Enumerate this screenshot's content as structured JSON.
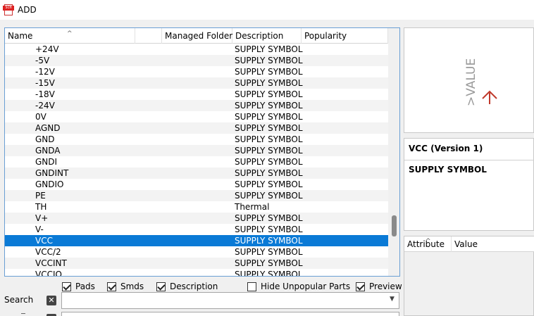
{
  "window": {
    "title": "ADD",
    "icon": "sch-icon"
  },
  "table": {
    "columns": [
      "Name",
      "",
      "Managed Folder",
      "Description",
      "Popularity"
    ],
    "rows": [
      {
        "name": "+24V",
        "description": "SUPPLY SYMBOL"
      },
      {
        "name": "-5V",
        "description": "SUPPLY SYMBOL"
      },
      {
        "name": "-12V",
        "description": "SUPPLY SYMBOL"
      },
      {
        "name": "-15V",
        "description": "SUPPLY SYMBOL"
      },
      {
        "name": "-18V",
        "description": "SUPPLY SYMBOL"
      },
      {
        "name": "-24V",
        "description": "SUPPLY SYMBOL"
      },
      {
        "name": "0V",
        "description": "SUPPLY SYMBOL"
      },
      {
        "name": "AGND",
        "description": "SUPPLY SYMBOL"
      },
      {
        "name": "GND",
        "description": "SUPPLY SYMBOL"
      },
      {
        "name": "GNDA",
        "description": "SUPPLY SYMBOL"
      },
      {
        "name": "GNDI",
        "description": "SUPPLY SYMBOL"
      },
      {
        "name": "GNDINT",
        "description": "SUPPLY SYMBOL"
      },
      {
        "name": "GNDIO",
        "description": "SUPPLY SYMBOL"
      },
      {
        "name": "PE",
        "description": "SUPPLY SYMBOL"
      },
      {
        "name": "TH",
        "description": "Thermal"
      },
      {
        "name": "V+",
        "description": "SUPPLY SYMBOL"
      },
      {
        "name": "V-",
        "description": "SUPPLY SYMBOL"
      },
      {
        "name": "VCC",
        "description": "SUPPLY SYMBOL",
        "selected": true
      },
      {
        "name": "VCC/2",
        "description": "SUPPLY SYMBOL"
      },
      {
        "name": "VCCINT",
        "description": "SUPPLY SYMBOL"
      },
      {
        "name": "VCCIO",
        "description": "SUPPLY SYMBOL"
      }
    ]
  },
  "preview": {
    "symbol_text": ">VALUE",
    "arrow_color": "#c0392b",
    "text_color": "#9a9a9a"
  },
  "info": {
    "title": "VCC (Version 1)",
    "description": "SUPPLY SYMBOL"
  },
  "attributes": {
    "columns": [
      "Attribute",
      "Value"
    ]
  },
  "options": [
    {
      "label": "Pads",
      "checked": true
    },
    {
      "label": "Smds",
      "checked": true
    },
    {
      "label": "Description",
      "checked": true
    },
    {
      "label": "Hide Unpopular Parts",
      "checked": false
    },
    {
      "label": "Preview",
      "checked": true
    }
  ],
  "search": {
    "label": "Search",
    "value": ""
  },
  "colors": {
    "selection": "#0a7ad6",
    "grid_border": "#6a9fd4"
  }
}
